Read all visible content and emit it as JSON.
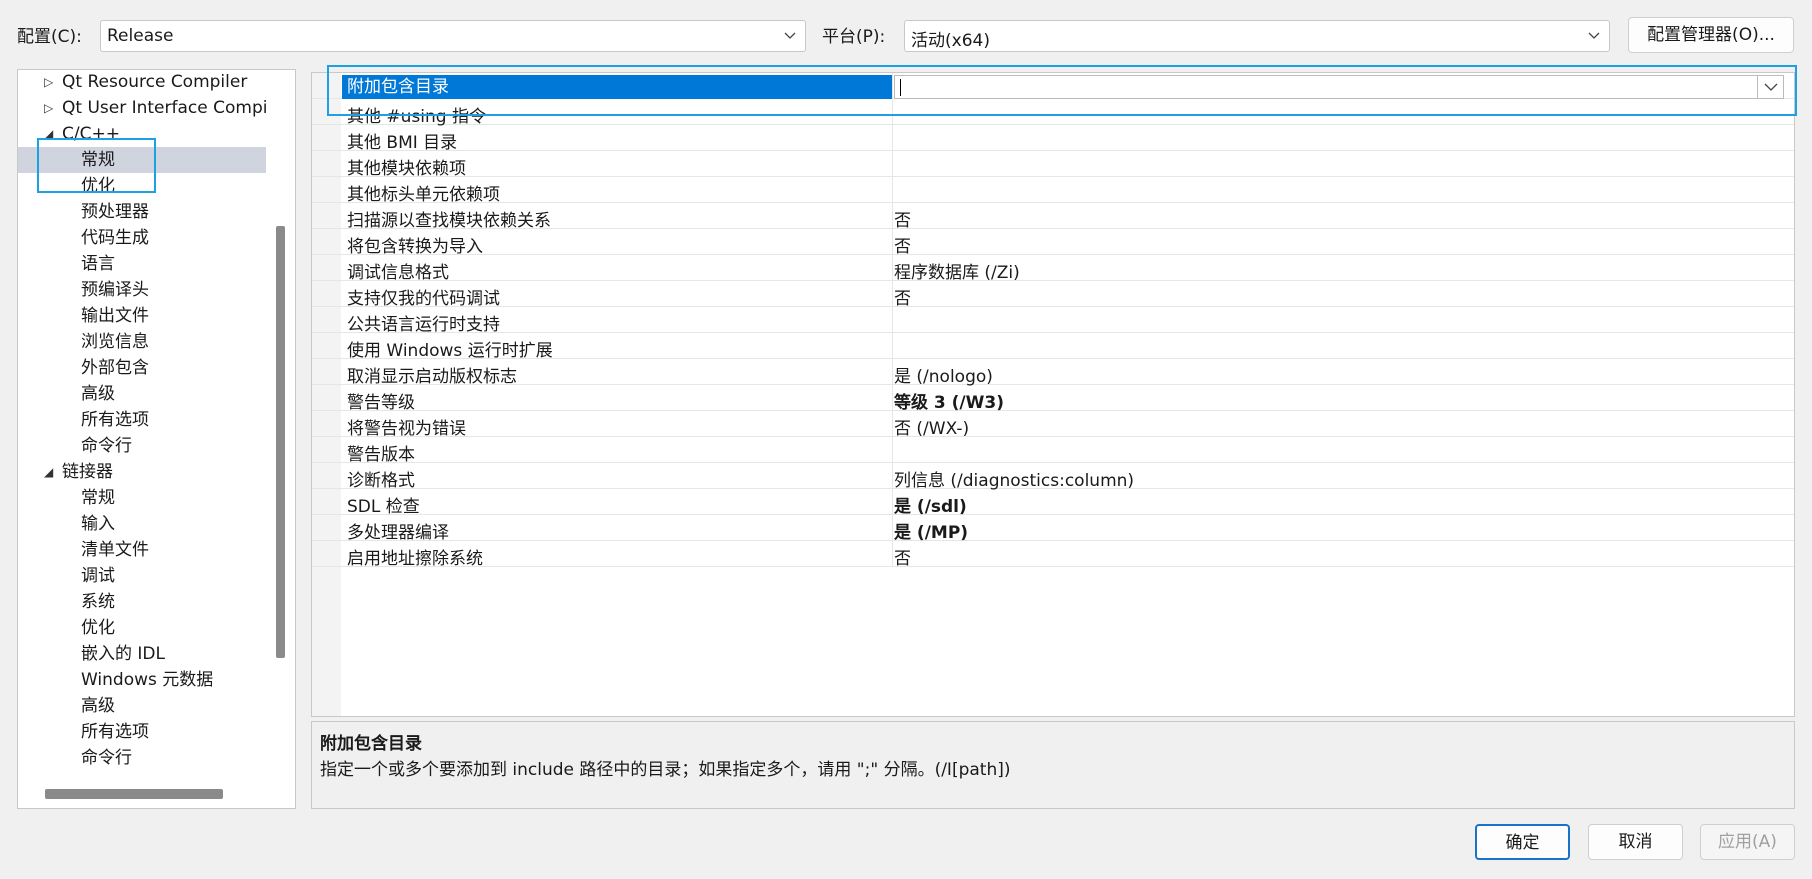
{
  "toolbar": {
    "config_label": "配置(C):",
    "config_value": "Release",
    "platform_label": "平台(P):",
    "platform_value": "活动(x64)",
    "config_manager": "配置管理器(O)..."
  },
  "tree": {
    "items": [
      {
        "label": "Qt Resource Compiler",
        "level": 1,
        "expander": "collapsed"
      },
      {
        "label": "Qt User Interface Compi",
        "level": 1,
        "expander": "collapsed"
      },
      {
        "label": "C/C++",
        "level": 1,
        "expander": "expanded"
      },
      {
        "label": "常规",
        "level": 2,
        "selected": true
      },
      {
        "label": "优化",
        "level": 2
      },
      {
        "label": "预处理器",
        "level": 2
      },
      {
        "label": "代码生成",
        "level": 2
      },
      {
        "label": "语言",
        "level": 2
      },
      {
        "label": "预编译头",
        "level": 2
      },
      {
        "label": "输出文件",
        "level": 2
      },
      {
        "label": "浏览信息",
        "level": 2
      },
      {
        "label": "外部包含",
        "level": 2
      },
      {
        "label": "高级",
        "level": 2
      },
      {
        "label": "所有选项",
        "level": 2
      },
      {
        "label": "命令行",
        "level": 2
      },
      {
        "label": "链接器",
        "level": 1,
        "expander": "expanded"
      },
      {
        "label": "常规",
        "level": 2
      },
      {
        "label": "输入",
        "level": 2
      },
      {
        "label": "清单文件",
        "level": 2
      },
      {
        "label": "调试",
        "level": 2
      },
      {
        "label": "系统",
        "level": 2
      },
      {
        "label": "优化",
        "level": 2
      },
      {
        "label": "嵌入的 IDL",
        "level": 2
      },
      {
        "label": "Windows 元数据",
        "level": 2
      },
      {
        "label": "高级",
        "level": 2
      },
      {
        "label": "所有选项",
        "level": 2
      },
      {
        "label": "命令行",
        "level": 2
      }
    ]
  },
  "grid": {
    "rows": [
      {
        "name": "附加包含目录",
        "value": "",
        "bold": false,
        "selected": true
      },
      {
        "name": "其他 #using 指令",
        "value": "",
        "bold": false
      },
      {
        "name": "其他 BMI 目录",
        "value": "",
        "bold": false
      },
      {
        "name": "其他模块依赖项",
        "value": "",
        "bold": false
      },
      {
        "name": "其他标头单元依赖项",
        "value": "",
        "bold": false
      },
      {
        "name": "扫描源以查找模块依赖关系",
        "value": "否",
        "bold": false
      },
      {
        "name": "将包含转换为导入",
        "value": "否",
        "bold": false
      },
      {
        "name": "调试信息格式",
        "value": "程序数据库 (/Zi)",
        "bold": false
      },
      {
        "name": "支持仅我的代码调试",
        "value": "否",
        "bold": false
      },
      {
        "name": "公共语言运行时支持",
        "value": "",
        "bold": false
      },
      {
        "name": "使用 Windows 运行时扩展",
        "value": "",
        "bold": false
      },
      {
        "name": "取消显示启动版权标志",
        "value": "是 (/nologo)",
        "bold": false
      },
      {
        "name": "警告等级",
        "value": "等级 3 (/W3)",
        "bold": true
      },
      {
        "name": "将警告视为错误",
        "value": "否 (/WX-)",
        "bold": false
      },
      {
        "name": "警告版本",
        "value": "",
        "bold": false
      },
      {
        "name": "诊断格式",
        "value": "列信息 (/diagnostics:column)",
        "bold": false
      },
      {
        "name": "SDL 检查",
        "value": "是 (/sdl)",
        "bold": true
      },
      {
        "name": "多处理器编译",
        "value": "是 (/MP)",
        "bold": true
      },
      {
        "name": "启用地址擦除系统",
        "value": "否",
        "bold": false
      }
    ]
  },
  "description": {
    "title": "附加包含目录",
    "text": "指定一个或多个要添加到 include 路径中的目录；如果指定多个，请用 \";\" 分隔。(/I[path])"
  },
  "footer": {
    "ok": "确定",
    "cancel": "取消",
    "apply": "应用(A)"
  },
  "colors": {
    "selection": "#0078d7",
    "highlight_annotation": "#1ea1e0",
    "tree_selected": "#cfd4de"
  }
}
